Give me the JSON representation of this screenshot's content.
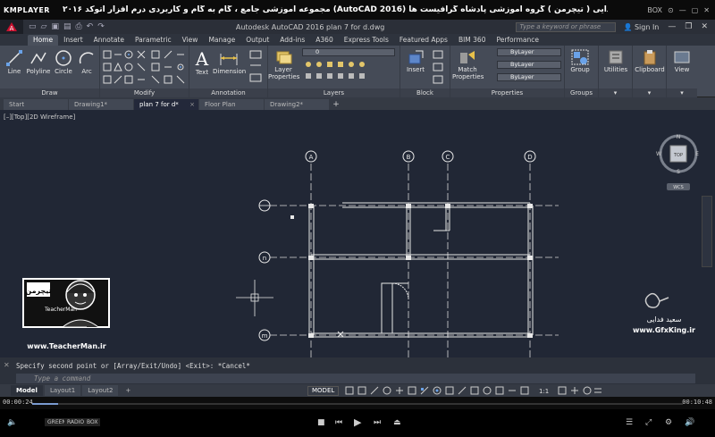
{
  "player": {
    "logo": "KMPLAYER",
    "title": "مجموعه آموزشی جامع ، گام به گام و کاربردی درم افزار  اتوکد ۲۰۱۶ (AutoCAD 2016)  مدرس : سعید فدایی ( تیچرمن ) گروه آموزشی پادشاه گرافیست ها",
    "top_controls": [
      "BOX",
      "⊙",
      "—",
      "▢",
      "✕"
    ],
    "time_elapsed": "00:00:24",
    "time_total": "00:10:48",
    "progress": 0.04,
    "button_labels": [
      "GREEN",
      "RADIO",
      "BOX"
    ]
  },
  "acad": {
    "logo": "A",
    "file_title": "Autodesk AutoCAD 2016    plan 7 for d.dwg",
    "search_placeholder": "Type a keyword or phrase",
    "signin": "Sign In",
    "ribbon_tabs": [
      "Home",
      "Insert",
      "Annotate",
      "Parametric",
      "View",
      "Manage",
      "Output",
      "Add-ins",
      "A360",
      "Express Tools",
      "Featured Apps",
      "BIM 360",
      "Performance"
    ],
    "active_tab": "Home",
    "panels": {
      "draw": {
        "title": "Draw",
        "buttons": [
          "Line",
          "Polyline",
          "Circle",
          "Arc"
        ]
      },
      "modify": {
        "title": "Modify"
      },
      "annotation": {
        "title": "Annotation",
        "buttons": [
          "Text",
          "Dimension"
        ]
      },
      "layers": {
        "title": "Layers",
        "buttons": [
          "Layer Properties"
        ],
        "layer_value": "0"
      },
      "block": {
        "title": "Block",
        "buttons": [
          "Insert"
        ]
      },
      "properties": {
        "title": "Properties",
        "buttons": [
          "Match Properties"
        ],
        "bylayer": [
          "ByLayer",
          "ByLayer",
          "ByLayer"
        ]
      },
      "groups": {
        "title": "Groups",
        "buttons": [
          "Group"
        ]
      },
      "utilities": {
        "buttons": [
          "Utilities"
        ]
      },
      "clipboard": {
        "buttons": [
          "Clipboard"
        ]
      },
      "view": {
        "buttons": [
          "View"
        ]
      }
    },
    "file_tabs": [
      "Start",
      "Drawing1*",
      "plan 7 for d*",
      "Floor Plan Sample*",
      "Drawing2*"
    ],
    "active_file_tab": "plan 7 for d*",
    "viewport_label": "[–][Top][2D Wireframe]",
    "viewcube": {
      "face": "TOP",
      "n": "N",
      "s": "S",
      "e": "E",
      "w": "W",
      "wcs": "WCS"
    },
    "grid_bubbles_top": [
      "A",
      "B",
      "C",
      "D"
    ],
    "grid_bubbles_left": [
      "",
      "n",
      "m"
    ],
    "command_history": "Specify second point or [Array/Exit/Undo] <Exit>: *Cancel*",
    "command_placeholder": "Type a command",
    "layout_tabs": [
      "Model",
      "Layout1",
      "Layout2"
    ],
    "active_layout": "Model",
    "status_model": "MODEL",
    "scale": "1:1"
  },
  "overlays": {
    "teacher_site": "www.TeacherMan.ir",
    "teacher_name": "TeacherMan",
    "teacher_fa": "تیچرمن",
    "gfx_name": "سعید فدایی",
    "gfx_site": "www.GfxKing.ir"
  }
}
